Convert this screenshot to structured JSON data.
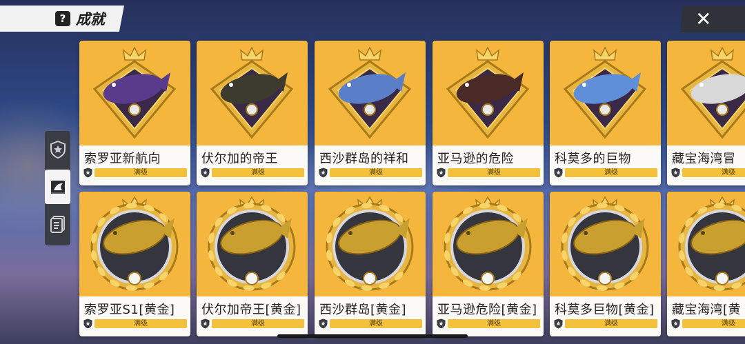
{
  "header": {
    "title": "成就",
    "help_icon": "?"
  },
  "close_button": {
    "label": "✕"
  },
  "side_tabs": [
    {
      "name": "star-badge-icon",
      "active": false
    },
    {
      "name": "fish-book-icon",
      "active": true
    },
    {
      "name": "card-list-icon",
      "active": false
    }
  ],
  "colors": {
    "card_bg": "#f4b63c",
    "level_bar": "#f4c23a",
    "panel_dark": "#2f3238"
  },
  "rows": [
    {
      "cards": [
        {
          "name": "索罗亚新航向",
          "level": "满级",
          "fish_color": "#5a3a8a",
          "emblem": "gold-diamond-crown"
        },
        {
          "name": "伏尔加的帝王",
          "level": "满级",
          "fish_color": "#3d3a30",
          "emblem": "gold-diamond-crown"
        },
        {
          "name": "西沙群岛的祥和",
          "level": "满级",
          "fish_color": "#5a7fc8",
          "emblem": "gold-diamond-crown"
        },
        {
          "name": "亚马逊的危险",
          "level": "满级",
          "fish_color": "#4a2a26",
          "emblem": "gold-diamond-crown"
        },
        {
          "name": "科莫多的巨物",
          "level": "满级",
          "fish_color": "#5f8fd8",
          "emblem": "gold-diamond-crown"
        },
        {
          "name": "藏宝海湾冒",
          "level": "满级",
          "fish_color": "#d8d8d8",
          "emblem": "gold-diamond-crown"
        }
      ]
    },
    {
      "cards": [
        {
          "name": "索罗亚S1[黄金]",
          "level": "满级",
          "fish_color": "#c9a030",
          "emblem": "gold-laurel-crown"
        },
        {
          "name": "伏尔加帝王[黄金]",
          "level": "满级",
          "fish_color": "#c9a030",
          "emblem": "gold-laurel-crown"
        },
        {
          "name": "西沙群岛[黄金]",
          "level": "满级",
          "fish_color": "#c9a030",
          "emblem": "gold-laurel-crown"
        },
        {
          "name": "亚马逊危险[黄金]",
          "level": "满级",
          "fish_color": "#c9a030",
          "emblem": "gold-laurel-crown"
        },
        {
          "name": "科莫多巨物[黄金]",
          "level": "满级",
          "fish_color": "#c9a030",
          "emblem": "gold-laurel-crown"
        },
        {
          "name": "藏宝海湾[黄",
          "level": "满级",
          "fish_color": "#c9a030",
          "emblem": "gold-laurel-crown"
        }
      ]
    }
  ]
}
